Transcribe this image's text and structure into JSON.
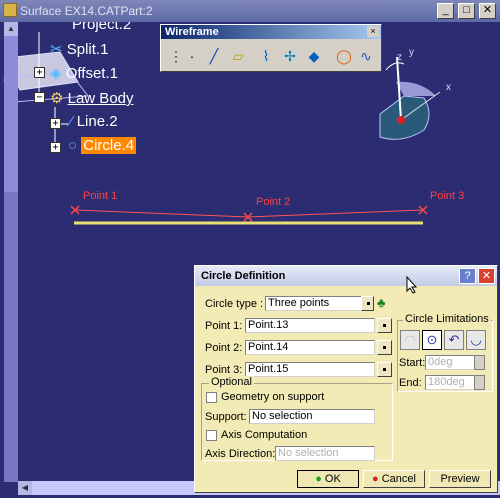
{
  "window": {
    "title": "Surface EX14.CATPart:2",
    "minimize": "_",
    "maximize": "□",
    "close": "✕"
  },
  "tree": {
    "items": [
      {
        "label": "Project.2"
      },
      {
        "label": "Split.1"
      },
      {
        "label": "Offset.1"
      },
      {
        "label": "Law Body"
      },
      {
        "label": "Line.2"
      },
      {
        "label": "Circle.4"
      }
    ]
  },
  "toolbar": {
    "title": "Wireframe",
    "close": "×"
  },
  "viewport": {
    "points": [
      {
        "label": "Point 1"
      },
      {
        "label": "Point 2"
      },
      {
        "label": "Point 3"
      }
    ],
    "compass": {
      "x": "x",
      "y": "y",
      "z": "z"
    }
  },
  "dialog": {
    "title": "Circle Definition",
    "help": "?",
    "close": "✕",
    "circle_type_label": "Circle type :",
    "circle_type_value": "Three points",
    "point1_label": "Point 1:",
    "point1_value": "Point.13",
    "point2_label": "Point 2:",
    "point2_value": "Point.14",
    "point3_label": "Point 3:",
    "point3_value": "Point.15",
    "optional_legend": "Optional",
    "geometry_on_support": "Geometry on support",
    "support_label": "Support:",
    "support_value": "No selection",
    "axis_computation": "Axis Computation",
    "axis_direction_label": "Axis Direction:",
    "axis_direction_value": "No selection",
    "limitations_legend": "Circle Limitations",
    "start_label": "Start:",
    "start_value": "0deg",
    "end_label": "End:",
    "end_value": "180deg",
    "ok": "OK",
    "cancel": "Cancel",
    "preview": "Preview"
  },
  "colors": {
    "background": "#2c2c72",
    "selected_item": "#ff8800",
    "point_marker": "#ff3333",
    "dialog_bg": "#f2ebb5"
  }
}
